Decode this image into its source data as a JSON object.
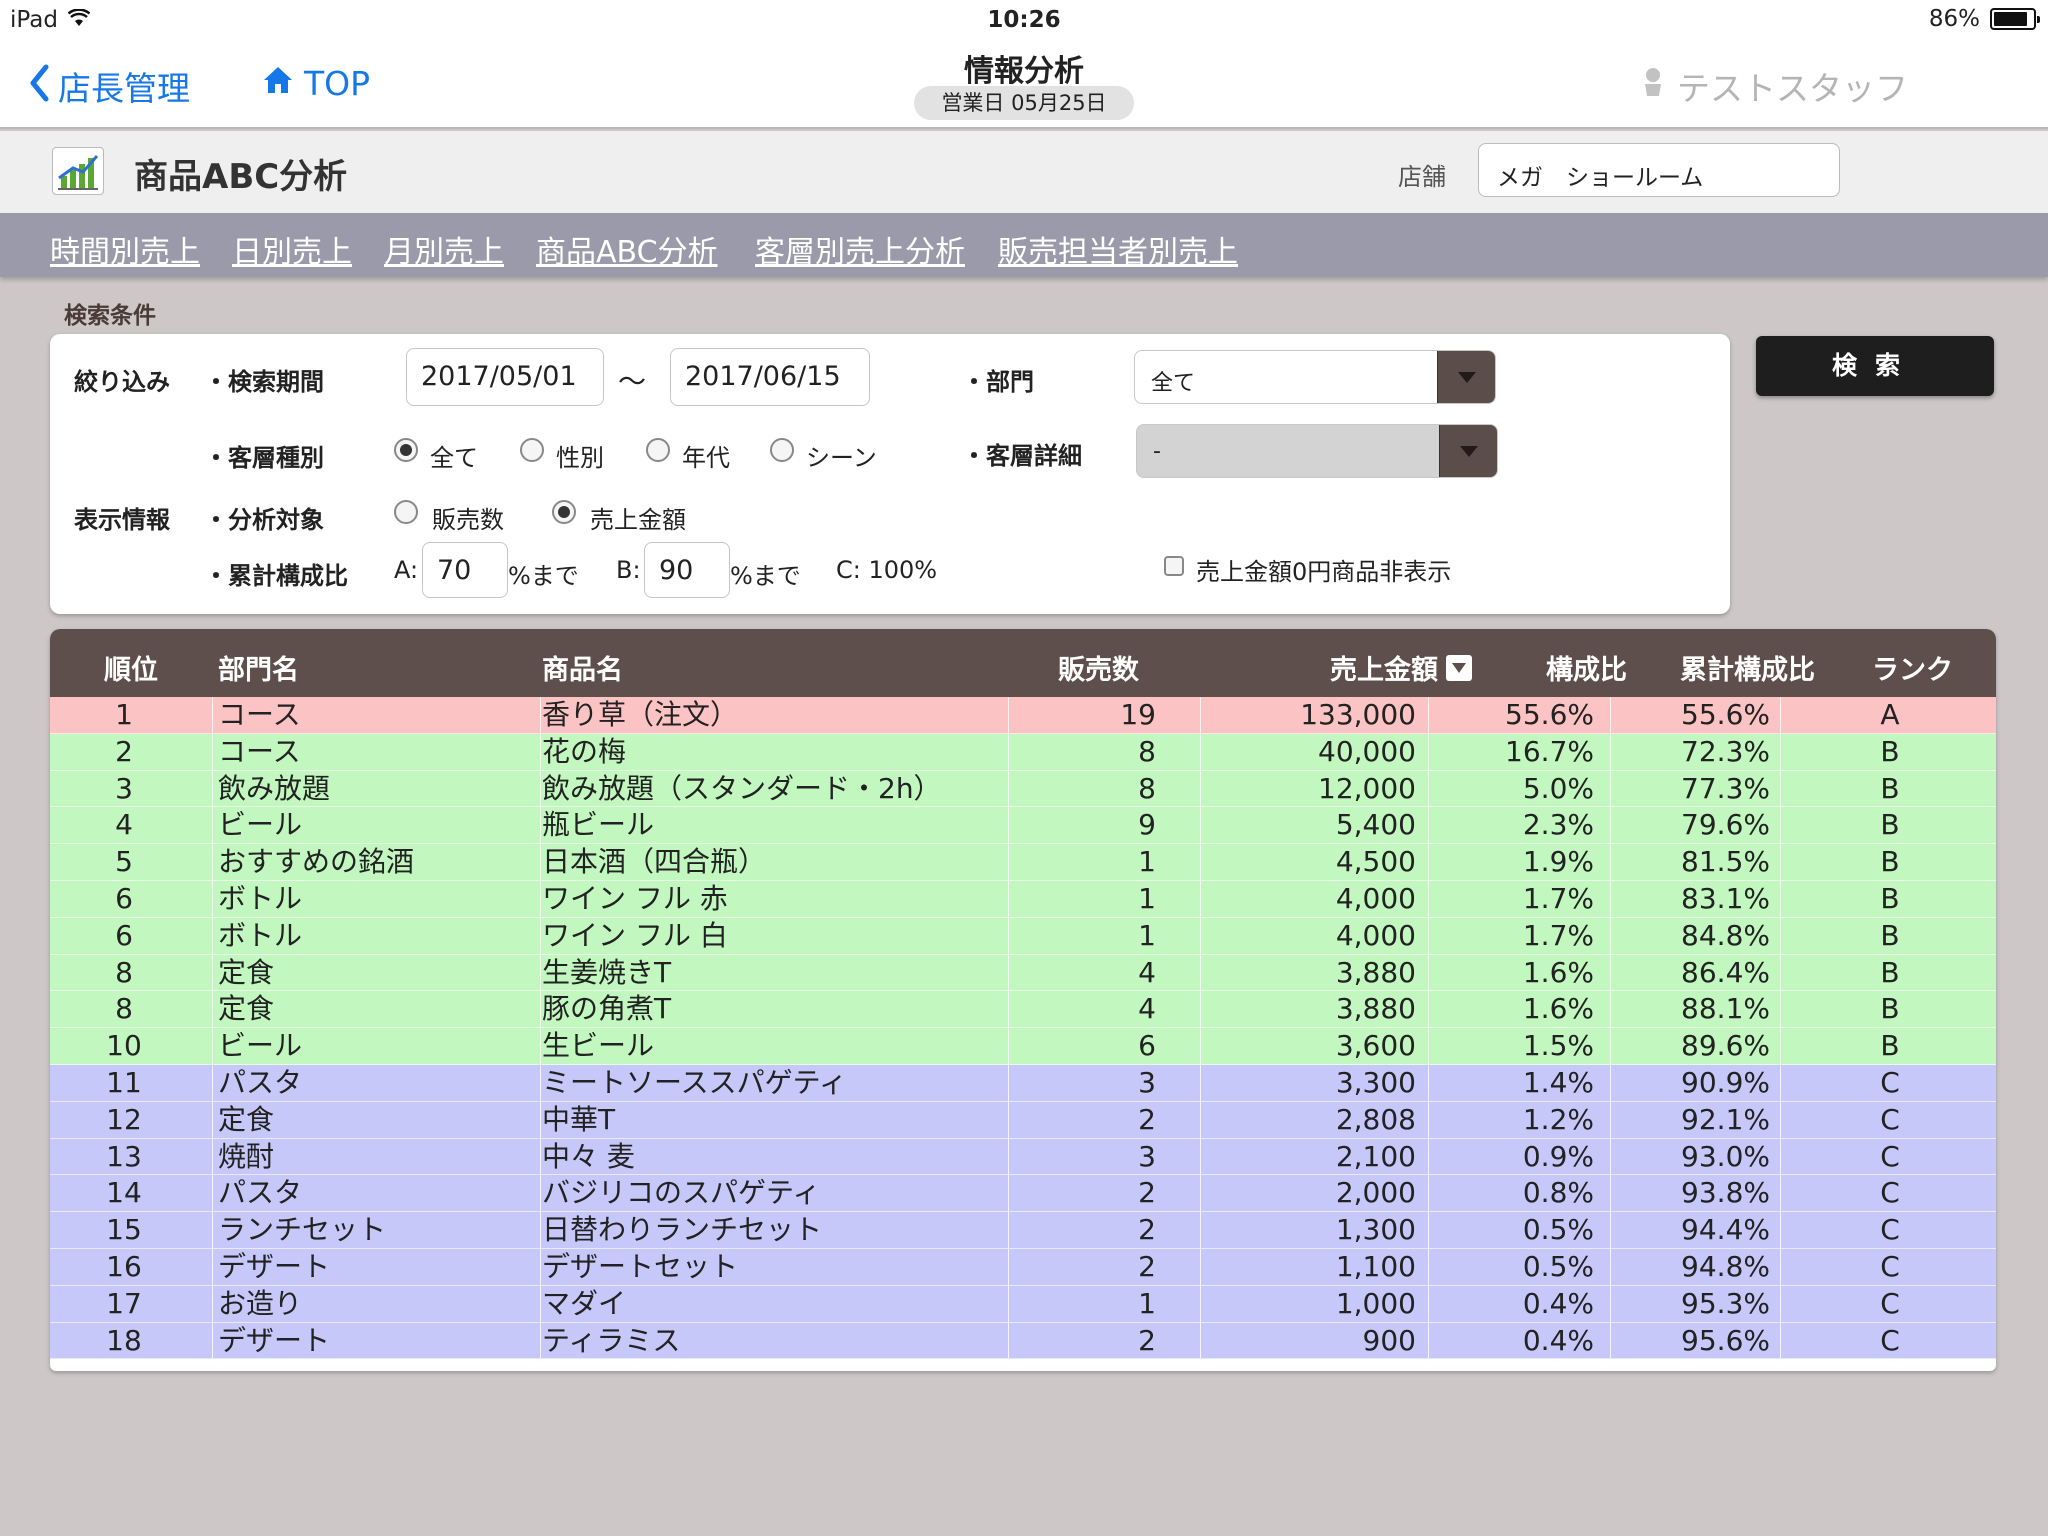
{
  "status_bar": {
    "device": "iPad",
    "time": "10:26",
    "battery": "86%",
    "battery_level": 0.86
  },
  "nav": {
    "back_label": "店長管理",
    "top_label": "TOP",
    "title": "情報分析",
    "business_date": "営業日 05月25日",
    "user": "テストスタッフ"
  },
  "page": {
    "title": "商品ABC分析",
    "store_label": "店舗",
    "store_value": "メガ　ショールーム"
  },
  "tabs": [
    "時間別売上",
    "日別売上",
    "月別売上",
    "商品ABC分析",
    "客層別売上分析",
    "販売担当者別売上"
  ],
  "search": {
    "section_label": "検索条件",
    "filter_label": "絞り込み",
    "period_label": "・検索期間",
    "period_from": "2017/05/01",
    "period_sep": "〜",
    "period_to": "2017/06/15",
    "dept_label": "・部門",
    "dept_value": "全て",
    "segment_label": "・客層種別",
    "segment_options": [
      "全て",
      "性別",
      "年代",
      "シーン"
    ],
    "segment_selected": 0,
    "segment_detail_label": "・客層詳細",
    "segment_detail_value": "-",
    "display_label": "表示情報",
    "target_label": "・分析対象",
    "target_options": [
      "販売数",
      "売上金額"
    ],
    "target_selected": 1,
    "ratio_label": "・累計構成比",
    "a_label": "A:",
    "a_value": "70",
    "a_suffix": "%まで",
    "b_label": "B:",
    "b_value": "90",
    "b_suffix": "%まで",
    "c_text": "C: 100%",
    "hide_zero_label": "売上金額0円商品非表示",
    "search_button": "検索"
  },
  "table": {
    "headers": {
      "rank": "順位",
      "dept": "部門名",
      "product": "商品名",
      "qty": "販売数",
      "sales": "売上金額",
      "ratio": "構成比",
      "cum": "累計構成比",
      "grade": "ランク"
    },
    "rows": [
      {
        "rank": "1",
        "dept": "コース",
        "product": "香り草（注文）",
        "qty": "19",
        "sales": "133,000",
        "ratio": "55.6%",
        "cum": "55.6%",
        "grade": "A"
      },
      {
        "rank": "2",
        "dept": "コース",
        "product": "花の梅",
        "qty": "8",
        "sales": "40,000",
        "ratio": "16.7%",
        "cum": "72.3%",
        "grade": "B"
      },
      {
        "rank": "3",
        "dept": "飲み放題",
        "product": "飲み放題（スタンダード・2h）",
        "qty": "8",
        "sales": "12,000",
        "ratio": "5.0%",
        "cum": "77.3%",
        "grade": "B"
      },
      {
        "rank": "4",
        "dept": "ビール",
        "product": "瓶ビール",
        "qty": "9",
        "sales": "5,400",
        "ratio": "2.3%",
        "cum": "79.6%",
        "grade": "B"
      },
      {
        "rank": "5",
        "dept": "おすすめの銘酒",
        "product": "日本酒（四合瓶）",
        "qty": "1",
        "sales": "4,500",
        "ratio": "1.9%",
        "cum": "81.5%",
        "grade": "B"
      },
      {
        "rank": "6",
        "dept": "ボトル",
        "product": "ワイン フル 赤",
        "qty": "1",
        "sales": "4,000",
        "ratio": "1.7%",
        "cum": "83.1%",
        "grade": "B"
      },
      {
        "rank": "6",
        "dept": "ボトル",
        "product": "ワイン フル 白",
        "qty": "1",
        "sales": "4,000",
        "ratio": "1.7%",
        "cum": "84.8%",
        "grade": "B"
      },
      {
        "rank": "8",
        "dept": "定食",
        "product": "生姜焼きT",
        "qty": "4",
        "sales": "3,880",
        "ratio": "1.6%",
        "cum": "86.4%",
        "grade": "B"
      },
      {
        "rank": "8",
        "dept": "定食",
        "product": "豚の角煮T",
        "qty": "4",
        "sales": "3,880",
        "ratio": "1.6%",
        "cum": "88.1%",
        "grade": "B"
      },
      {
        "rank": "10",
        "dept": "ビール",
        "product": "生ビール",
        "qty": "6",
        "sales": "3,600",
        "ratio": "1.5%",
        "cum": "89.6%",
        "grade": "B"
      },
      {
        "rank": "11",
        "dept": "パスタ",
        "product": "ミートソーススパゲティ",
        "qty": "3",
        "sales": "3,300",
        "ratio": "1.4%",
        "cum": "90.9%",
        "grade": "C"
      },
      {
        "rank": "12",
        "dept": "定食",
        "product": "中華T",
        "qty": "2",
        "sales": "2,808",
        "ratio": "1.2%",
        "cum": "92.1%",
        "grade": "C"
      },
      {
        "rank": "13",
        "dept": "焼酎",
        "product": "中々 麦",
        "qty": "3",
        "sales": "2,100",
        "ratio": "0.9%",
        "cum": "93.0%",
        "grade": "C"
      },
      {
        "rank": "14",
        "dept": "パスタ",
        "product": "バジリコのスパゲティ",
        "qty": "2",
        "sales": "2,000",
        "ratio": "0.8%",
        "cum": "93.8%",
        "grade": "C"
      },
      {
        "rank": "15",
        "dept": "ランチセット",
        "product": "日替わりランチセット",
        "qty": "2",
        "sales": "1,300",
        "ratio": "0.5%",
        "cum": "94.4%",
        "grade": "C"
      },
      {
        "rank": "16",
        "dept": "デザート",
        "product": "デザートセット",
        "qty": "2",
        "sales": "1,100",
        "ratio": "0.5%",
        "cum": "94.8%",
        "grade": "C"
      },
      {
        "rank": "17",
        "dept": "お造り",
        "product": "マダイ",
        "qty": "1",
        "sales": "1,000",
        "ratio": "0.4%",
        "cum": "95.3%",
        "grade": "C"
      },
      {
        "rank": "18",
        "dept": "デザート",
        "product": "ティラミス",
        "qty": "2",
        "sales": "900",
        "ratio": "0.4%",
        "cum": "95.6%",
        "grade": "C"
      }
    ]
  },
  "colors": {
    "accent_link": "#1677e8",
    "rank_a": "#fbc3c3",
    "rank_b": "#c2f8c0",
    "rank_c": "#c6c8fa",
    "table_header": "#5e4f4c"
  }
}
